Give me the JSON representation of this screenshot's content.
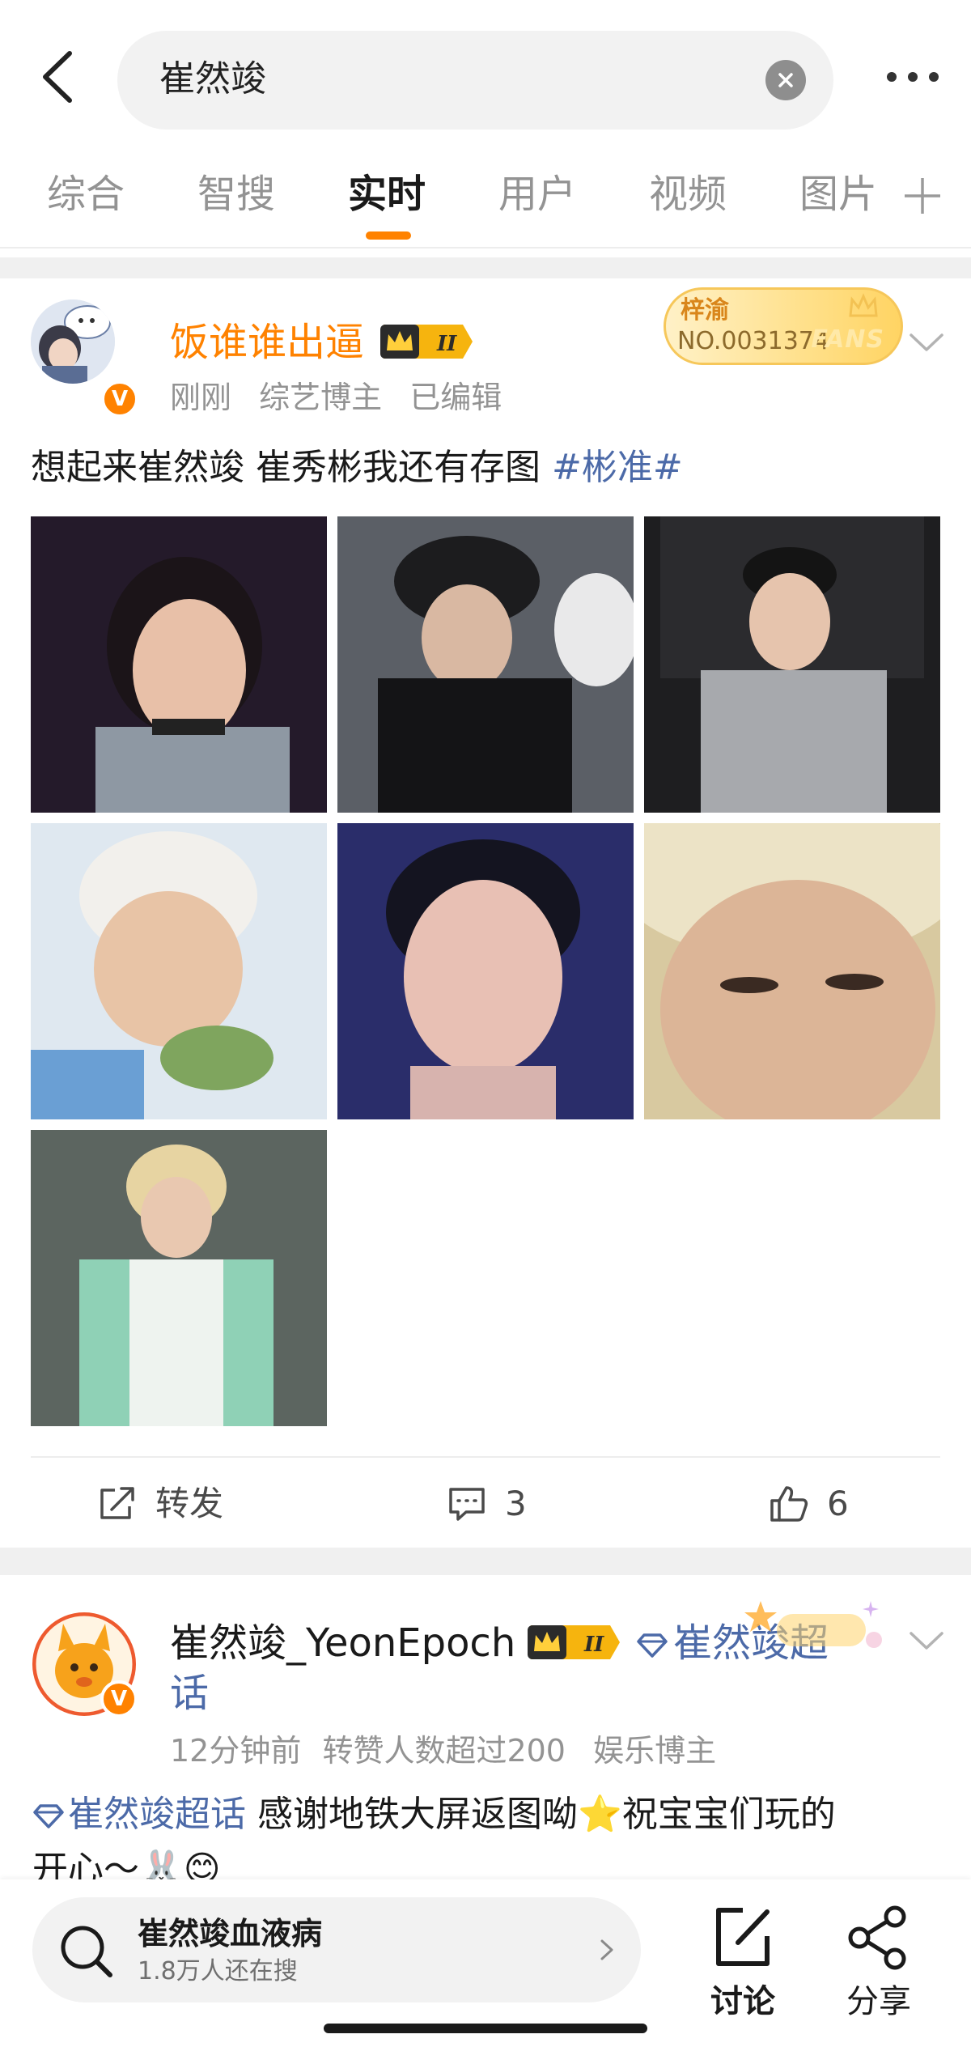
{
  "search": {
    "query": "崔然竣"
  },
  "tabs": [
    {
      "label": "综合"
    },
    {
      "label": "智搜"
    },
    {
      "label": "实时"
    },
    {
      "label": "用户"
    },
    {
      "label": "视频"
    },
    {
      "label": "图片"
    }
  ],
  "posts": [
    {
      "username": "饭谁谁出逼",
      "username_color": "#ff8200",
      "vip_level": "II",
      "fan_badge": {
        "name": "梓渝",
        "number": "NO.0031374",
        "word": "FANS"
      },
      "meta": [
        "刚刚",
        "综艺博主",
        "已编辑"
      ],
      "text": "想起来崔然竣 崔秀彬我还有存图 ",
      "hashtag": "#彬准#",
      "image_count": 7,
      "actions": {
        "repost_label": "转发",
        "comments": "3",
        "likes": "6"
      }
    },
    {
      "username": "崔然竣_YeonEpoch",
      "vip_level": "II",
      "supertopic_line1": "崔然竣超",
      "supertopic_line2": "话",
      "meta": [
        "12分钟前",
        "转赞人数超过200",
        "娱乐博主"
      ],
      "supertopic_link": "崔然竣超话",
      "text_line1": " 感谢地铁大屏返图呦⭐祝宝宝们玩的",
      "text_line2": "开心～🐰😊"
    }
  ],
  "bottom": {
    "hot_title": "崔然竣血液病",
    "hot_sub": "1.8万人还在搜",
    "discuss_label": "讨论",
    "share_label": "分享"
  },
  "colors": {
    "accent": "#ff8200",
    "link": "#4c6aa8",
    "muted": "#939393"
  }
}
